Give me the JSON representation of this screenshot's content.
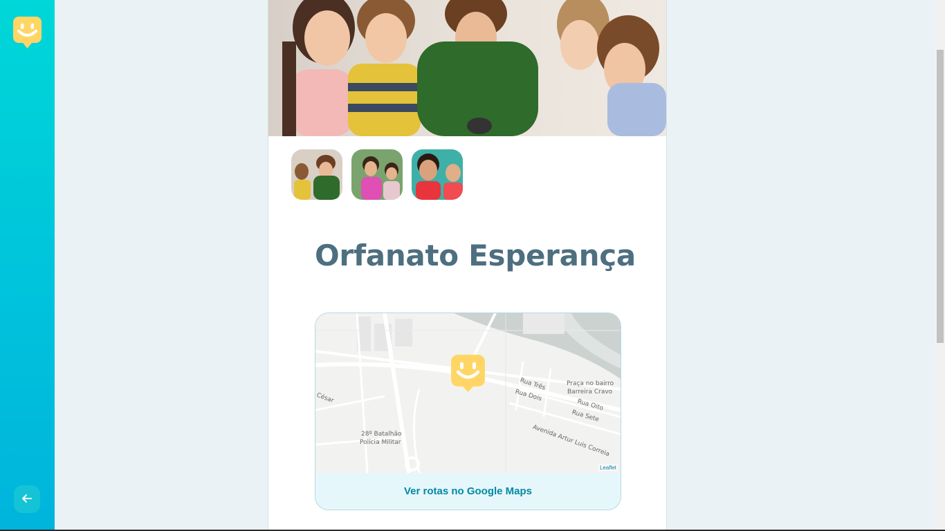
{
  "sidebar": {
    "logo": "happy-logo-icon",
    "back_icon": "arrow-left-icon"
  },
  "orphanage": {
    "name": "Orfanato Esperança"
  },
  "gallery": {
    "thumbnails": [
      "photo-1",
      "photo-2",
      "photo-3"
    ]
  },
  "map": {
    "directions_label": "Ver rotas no Google Maps",
    "attribution": "Leaflet",
    "labels": {
      "rua_tres": "Rua Três",
      "rua_dois": "Rua Dois",
      "praca_1": "Praça no bairro",
      "praca_2": "Barreira Cravo",
      "rua_oito": "Rua Oito",
      "rua_sete": "Rua Sete",
      "avenida": "Avenida Artur Luis Correia",
      "cesar": "César",
      "batalhao_1": "28º Batalhão",
      "batalhao_2": "Polícia Militar"
    }
  },
  "colors": {
    "accent": "#15c3d6",
    "title": "#4d6f80",
    "marker": "#ffd666",
    "link": "#0089a5"
  }
}
